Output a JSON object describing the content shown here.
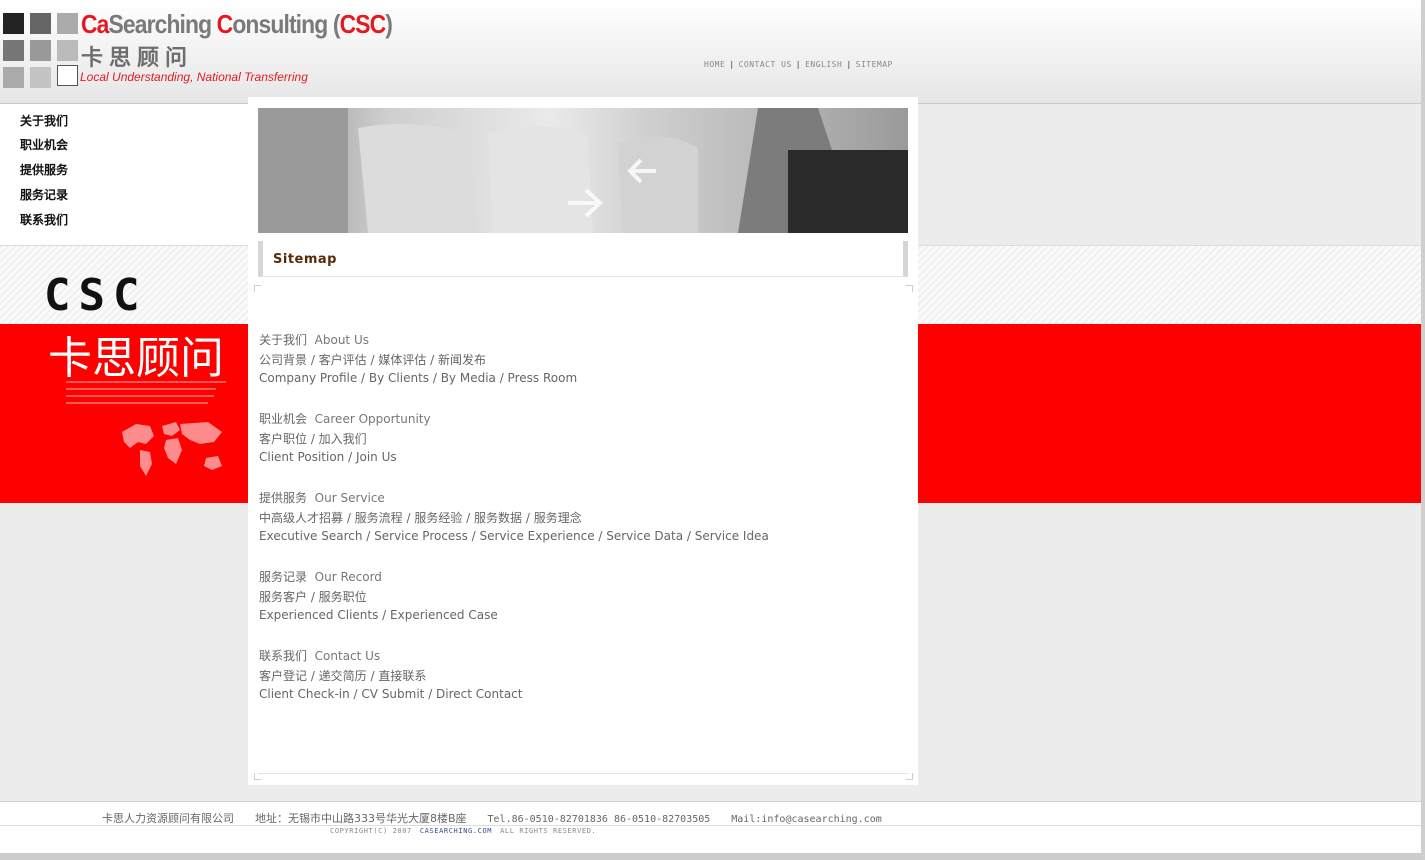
{
  "logo": {
    "name_part1": "Ca",
    "name_part2": "Searching ",
    "name_part3": "C",
    "name_part4": "onsulting (",
    "name_part5": "CSC",
    "name_part6": ")",
    "cn_name": "卡思顾问",
    "tagline": "Local Understanding, National Transferring"
  },
  "topnav": [
    "HOME",
    "CONTACT US",
    "ENGLISH",
    "SITEMAP"
  ],
  "leftnav": [
    "关于我们",
    "职业机会",
    "提供服务",
    "服务记录",
    "联系我们"
  ],
  "brand_block": {
    "csc": "CSC",
    "cn": "卡思顾问"
  },
  "page_title": "Sitemap",
  "sitemap": [
    {
      "cn": "关于我们",
      "en": "About Us",
      "cn_links": "公司背景 / 客户评估 / 媒体评估 / 新闻发布",
      "en_links": "Company Profile / By Clients / By Media / Press Room"
    },
    {
      "cn": "职业机会",
      "en": "Career Opportunity",
      "cn_links": "客户职位 / 加入我们",
      "en_links": "Client Position / Join Us"
    },
    {
      "cn": "提供服务",
      "en": "Our Service",
      "cn_links": "中高级人才招募 / 服务流程 / 服务经验 / 服务数据 / 服务理念",
      "en_links": "Executive Search / Service Process / Service Experience / Service Data / Service Idea"
    },
    {
      "cn": "服务记录",
      "en": "Our Record",
      "cn_links": "服务客户 / 服务职位",
      "en_links": "Experienced Clients / Experienced Case"
    },
    {
      "cn": "联系我们",
      "en": "Contact Us",
      "cn_links": "客户登记 / 递交简历 / 直接联系",
      "en_links": "Client Check-in / CV Submit / Direct Contact"
    }
  ],
  "footer": {
    "company": "卡思人力资源顾问有限公司",
    "address": "地址：无锡市中山路333号华光大厦8楼B座",
    "tel": "Tel.86-0510-82701836 86-0510-82703505",
    "mail": "Mail:info@casearching.com",
    "copyright": "COPYRIGHT(C) 2007",
    "site": "CASEARCHING.COM",
    "rights": "ALL RIGHTS RESERVED."
  },
  "colors": {
    "brand_red": "#ff0000",
    "logo_red": "#e21b22",
    "title_brown": "#5a2a08"
  }
}
